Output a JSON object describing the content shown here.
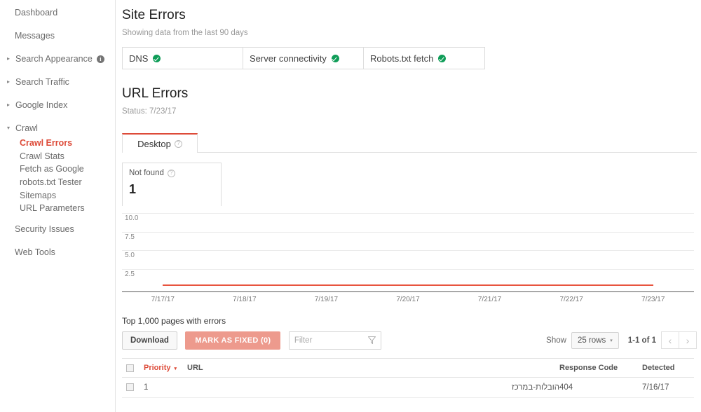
{
  "sidebar": {
    "items": [
      {
        "label": "Dashboard",
        "type": "link",
        "caret": ""
      },
      {
        "label": "Messages",
        "type": "link",
        "caret": ""
      },
      {
        "label": "Search Appearance",
        "type": "group",
        "caret": "▸",
        "badge": "i"
      },
      {
        "label": "Search Traffic",
        "type": "group",
        "caret": "▸"
      },
      {
        "label": "Google Index",
        "type": "group",
        "caret": "▸"
      },
      {
        "label": "Crawl",
        "type": "group-open",
        "caret": "▾"
      }
    ],
    "crawl_children": [
      {
        "label": "Crawl Errors",
        "active": true
      },
      {
        "label": "Crawl Stats",
        "active": false
      },
      {
        "label": "Fetch as Google",
        "active": false
      },
      {
        "label": "robots.txt Tester",
        "active": false
      },
      {
        "label": "Sitemaps",
        "active": false
      },
      {
        "label": "URL Parameters",
        "active": false
      }
    ],
    "footer_items": [
      {
        "label": "Security Issues"
      },
      {
        "label": "Web Tools"
      }
    ],
    "active_color": "#dd4b39"
  },
  "site_errors": {
    "title": "Site Errors",
    "subtitle": "Showing data from the last 90 days",
    "cells": [
      {
        "label": "DNS",
        "status": "ok"
      },
      {
        "label": "Server connectivity",
        "status": "ok"
      },
      {
        "label": "Robots.txt fetch",
        "status": "ok"
      }
    ],
    "ok_color": "#0f9d58"
  },
  "url_errors": {
    "title": "URL Errors",
    "status": "Status: 7/23/17",
    "tabs": [
      {
        "label": "Desktop",
        "help": "?",
        "selected": true
      }
    ],
    "cards": [
      {
        "title": "Not found",
        "help": "?",
        "value": "1"
      }
    ]
  },
  "chart_data": {
    "type": "line",
    "title": "",
    "xlabel": "",
    "ylabel": "",
    "x": [
      "7/17/17",
      "7/18/17",
      "7/19/17",
      "7/20/17",
      "7/21/17",
      "7/22/17",
      "7/23/17"
    ],
    "series": [
      {
        "name": "Not found",
        "values": [
          1,
          1,
          1,
          1,
          1,
          1,
          1
        ],
        "color": "#e8543f"
      }
    ],
    "yticks": [
      "10.0",
      "7.5",
      "5.0",
      "2.5"
    ],
    "ylim": [
      0,
      11
    ],
    "grid": true,
    "legend": "none"
  },
  "table": {
    "caption": "Top 1,000 pages with errors",
    "download_label": "Download",
    "mark_fixed_label": "MARK AS FIXED (0)",
    "mark_fixed_color": "#ed9a8d",
    "filter_placeholder": "Filter",
    "filter_value": "",
    "show_label": "Show",
    "rows_value": "25 rows",
    "range_label": "1-1 of 1",
    "prev_icon": "‹",
    "next_icon": "›",
    "columns": [
      "",
      "Priority",
      "URL",
      "Response Code",
      "Detected"
    ],
    "sort_column": "Priority",
    "sort_caret": "▾",
    "rows": [
      {
        "priority": "1",
        "url": "הובלות-במרכז",
        "response_code": "404",
        "detected": "7/16/17"
      }
    ]
  }
}
